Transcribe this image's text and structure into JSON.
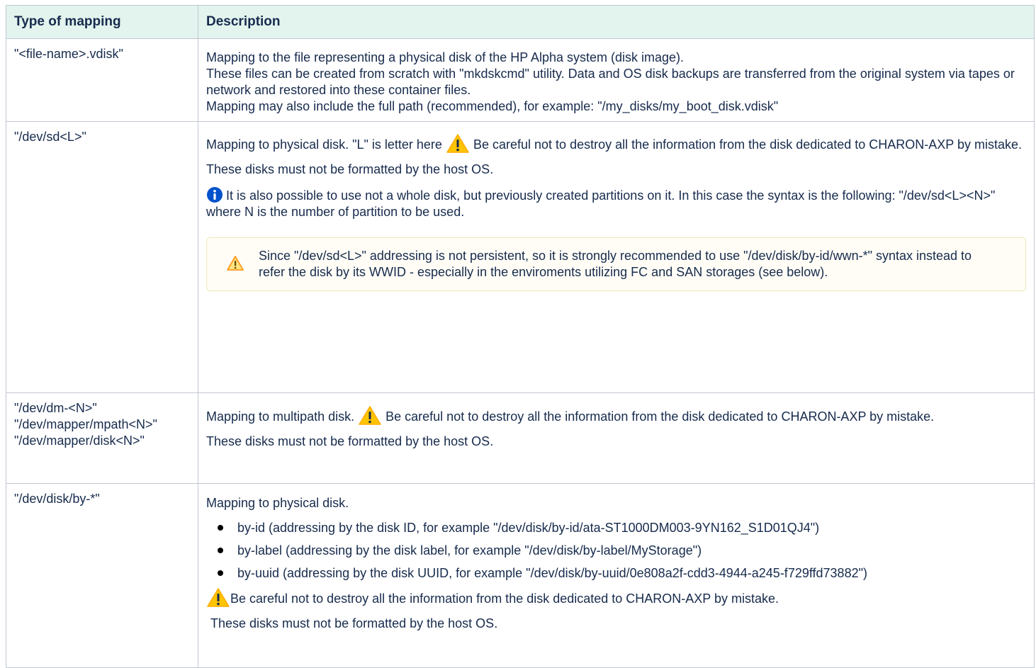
{
  "table": {
    "headers": [
      "Type of mapping",
      "Description"
    ],
    "rows": [
      {
        "type": [
          "\"<file-name>.vdisk\""
        ],
        "desc": [
          "Mapping to the file representing a physical disk of the HP Alpha system (disk image).",
          "These files can be created from scratch with \"mkdskcmd\" utility. Data and OS disk backups are transferred from the original system via tapes or network and restored into these container files.",
          "Mapping may also include the full path (recommended), for example: \"/my_disks/my_boot_disk.vdisk\""
        ]
      },
      {
        "type": [
          "\"/dev/sd<L>\""
        ],
        "desc_a": "Mapping to physical disk. \"L\" is letter here",
        "desc_b": "Be careful not to destroy all the information from the disk dedicated to CHARON-AXP by mistake.",
        "desc_c": "These disks must not be formatted by the host OS.",
        "info": "It is also possible to use not a whole disk, but previously created partitions on it. In this case the syntax is the following: \"/dev/sd<L><N>\" where N is the number of partition to be used.",
        "note": "Since \"/dev/sd<L>\" addressing is not persistent, so it is strongly recommended to use \"/dev/disk/by-id/wwn-*\" syntax instead to refer the disk by its WWID - especially in the enviroments utilizing FC and SAN storages (see below)."
      },
      {
        "type": [
          "\"/dev/dm-<N>\"",
          "\"/dev/mapper/mpath<N>\"",
          "\"/dev/mapper/disk<N>\""
        ],
        "desc_a": "Mapping to multipath disk.",
        "desc_b": "Be careful not to destroy all the information from the disk dedicated to CHARON-AXP by mistake.",
        "desc_c": "These disks must not be formatted by the host OS."
      },
      {
        "type": [
          "\"/dev/disk/by-*\""
        ],
        "desc_a": "Mapping to physical disk.",
        "bullets": [
          "by-id (addressing by the disk ID, for example \"/dev/disk/by-id/ata-ST1000DM003-9YN162_S1D01QJ4\")",
          "by-label (addressing by the disk label, for example \"/dev/disk/by-label/MyStorage\")",
          "by-uuid (addressing by the disk UUID, for example \"/dev/disk/by-uuid/0e808a2f-cdd3-4944-a245-f729ffd73882\")"
        ],
        "warning": "Be careful not to destroy all the information from the disk dedicated to CHARON-AXP by mistake.",
        "desc_c": "These disks must not be formatted by the host OS."
      }
    ]
  },
  "icons": {
    "warning": "warning-icon",
    "info": "info-icon",
    "note_warning": "warning-outline-icon"
  },
  "colors": {
    "header_bg": "#e3f4ee",
    "warning_yellow": "#ffc400",
    "info_blue": "#0052cc",
    "note_bg": "#fffdf6"
  }
}
